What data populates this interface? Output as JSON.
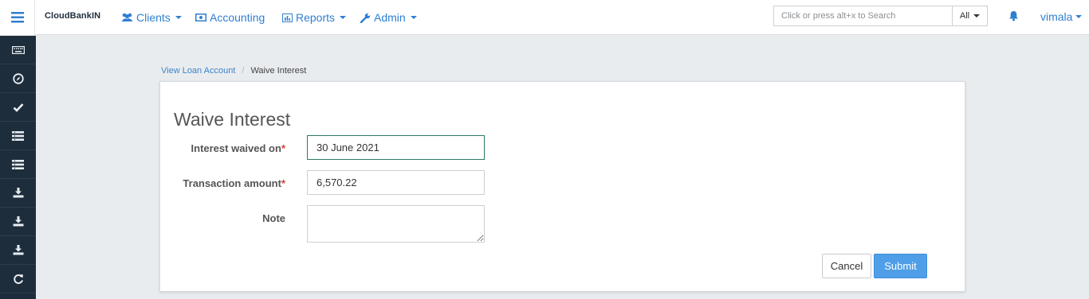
{
  "navbar": {
    "brand": "CloudBankIN",
    "items": [
      {
        "label": "Clients",
        "icon": "users-icon",
        "dropdown": true
      },
      {
        "label": "Accounting",
        "icon": "money-icon",
        "dropdown": false
      },
      {
        "label": "Reports",
        "icon": "bar-chart-icon",
        "dropdown": true
      },
      {
        "label": "Admin",
        "icon": "wrench-icon",
        "dropdown": true
      }
    ],
    "search": {
      "placeholder": "Click or press alt+x to Search",
      "value": ""
    },
    "search_scope": "All",
    "user": "vimala"
  },
  "sidebar": {
    "items": [
      {
        "icon": "keyboard-icon"
      },
      {
        "icon": "compass-icon"
      },
      {
        "icon": "check-icon"
      },
      {
        "icon": "list-icon"
      },
      {
        "icon": "list-icon"
      },
      {
        "icon": "download-icon"
      },
      {
        "icon": "download-icon"
      },
      {
        "icon": "download-icon"
      },
      {
        "icon": "refresh-icon"
      }
    ]
  },
  "breadcrumb": {
    "parent": "View Loan Account",
    "separator": "/",
    "current": "Waive Interest"
  },
  "form": {
    "title": "Waive Interest",
    "fields": [
      {
        "label": "Interest waived on",
        "required": true,
        "value": "30 June 2021"
      },
      {
        "label": "Transaction amount",
        "required": true,
        "value": "6,570.22"
      },
      {
        "label": "Note",
        "required": false,
        "value": ""
      }
    ],
    "required_marker": "*",
    "cancel_label": "Cancel",
    "submit_label": "Submit"
  },
  "colors": {
    "sidebar_bg": "#1d2d3c",
    "link": "#2f7fd1",
    "submit_bg": "#4f9ee8",
    "focus_border": "#2a7a68",
    "required": "#d43a3a"
  }
}
